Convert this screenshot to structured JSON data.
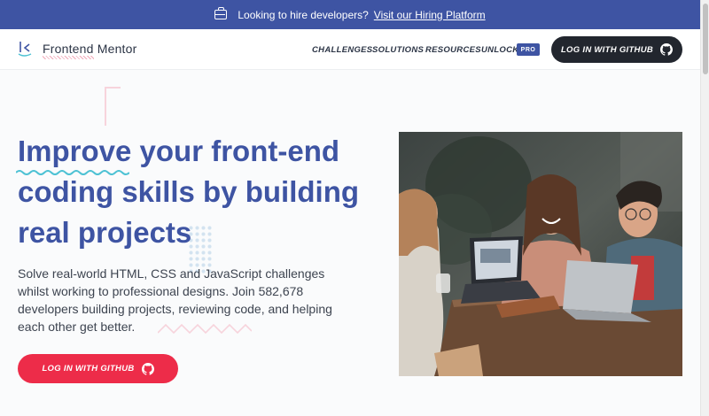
{
  "banner": {
    "text": "Looking to hire developers?",
    "link": "Visit our Hiring Platform",
    "icon": "briefcase-icon"
  },
  "brand": {
    "name": "Frontend Mentor"
  },
  "nav": {
    "items": [
      "CHALLENGES",
      "SOLUTIONS",
      "RESOURCES",
      "UNLOCK"
    ],
    "pro_badge": "PRO",
    "login": "LOG IN WITH GITHUB"
  },
  "hero": {
    "title_word1": "Improve",
    "title_rest1": " your front-end",
    "title_line2": "coding skills by building",
    "title_line3": "real projects",
    "description": "Solve real-world HTML, CSS and JavaScript challenges whilst working to professional designs. Join 582,678 developers building projects, reviewing code, and helping each other get better.",
    "cta": "LOG IN WITH GITHUB"
  },
  "colors": {
    "banner": "#3e54a3",
    "accent_red": "#ed2c49",
    "title": "#3e54a3",
    "dark_button": "#22262e",
    "wavy": "#4ec2d4"
  }
}
